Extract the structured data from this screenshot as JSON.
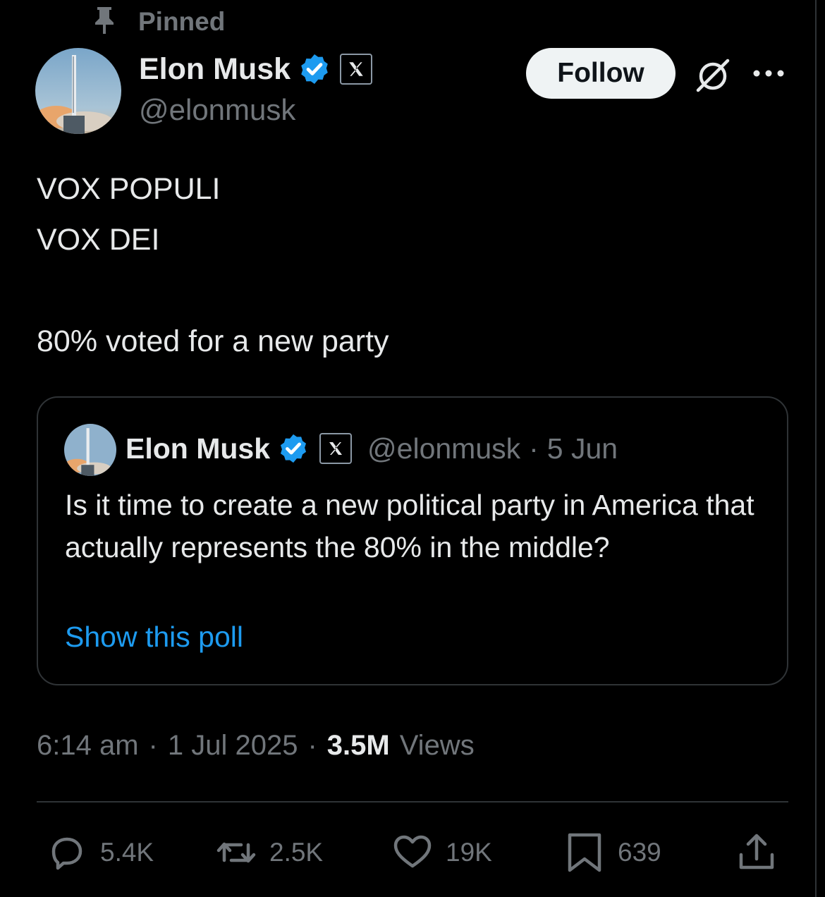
{
  "pinned": {
    "label": "Pinned",
    "icon": "pin-icon"
  },
  "author": {
    "name": "Elon Musk",
    "handle": "@elonmusk",
    "verified_icon": "verified-badge-icon",
    "affiliate_icon": "x-logo-icon"
  },
  "actions": {
    "follow_label": "Follow",
    "grok_icon": "grok-icon",
    "more_icon": "more-icon"
  },
  "tweet": {
    "lines": [
      "VOX POPULI",
      "VOX DEI",
      "80% voted for a new party"
    ]
  },
  "quote": {
    "name": "Elon Musk",
    "handle": "@elonmusk",
    "separator": "·",
    "date": "5 Jun",
    "text": "Is it time to create a new political party in America that actually represents the 80% in the middle?",
    "link": "Show this poll"
  },
  "meta": {
    "time": "6:14 am",
    "separator": "·",
    "date": "1 Jul 2025",
    "views_count": "3.5M",
    "views_label": "Views"
  },
  "stats": {
    "replies": "5.4K",
    "reposts": "2.5K",
    "likes": "19K",
    "bookmarks": "639"
  },
  "colors": {
    "background": "#000000",
    "text": "#e7e9ea",
    "muted": "#71767b",
    "accent": "#1d9bf0",
    "border": "#2f3336"
  }
}
